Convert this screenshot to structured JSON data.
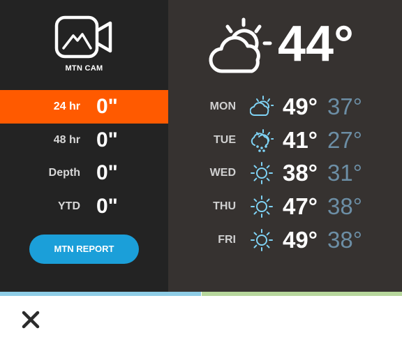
{
  "mtn_cam": {
    "label": "MTN CAM",
    "icon": "video-camera-mountain-icon"
  },
  "snow_totals": [
    {
      "period": "24 hr",
      "amount": "0\"",
      "active": true
    },
    {
      "period": "48 hr",
      "amount": "0\"",
      "active": false
    },
    {
      "period": "Depth",
      "amount": "0\"",
      "active": false
    },
    {
      "period": "YTD",
      "amount": "0\"",
      "active": false
    }
  ],
  "mtn_report_label": "MTN REPORT",
  "current": {
    "icon": "partly-sunny-icon",
    "temp": "44°"
  },
  "forecast": [
    {
      "day": "MON",
      "icon": "partly-cloudy-icon",
      "high": "49°",
      "low": "37°"
    },
    {
      "day": "TUE",
      "icon": "snow-sun-icon",
      "high": "41°",
      "low": "27°"
    },
    {
      "day": "WED",
      "icon": "sun-icon",
      "high": "38°",
      "low": "31°"
    },
    {
      "day": "THU",
      "icon": "sun-icon",
      "high": "47°",
      "low": "38°"
    },
    {
      "day": "FRI",
      "icon": "sun-icon",
      "high": "49°",
      "low": "38°"
    }
  ],
  "colors": {
    "accent": "#ff5a00",
    "button": "#1b9fd9",
    "icon_blue": "#7fd3f5",
    "low_temp": "#6c8ea5"
  },
  "close_icon": "close-icon"
}
